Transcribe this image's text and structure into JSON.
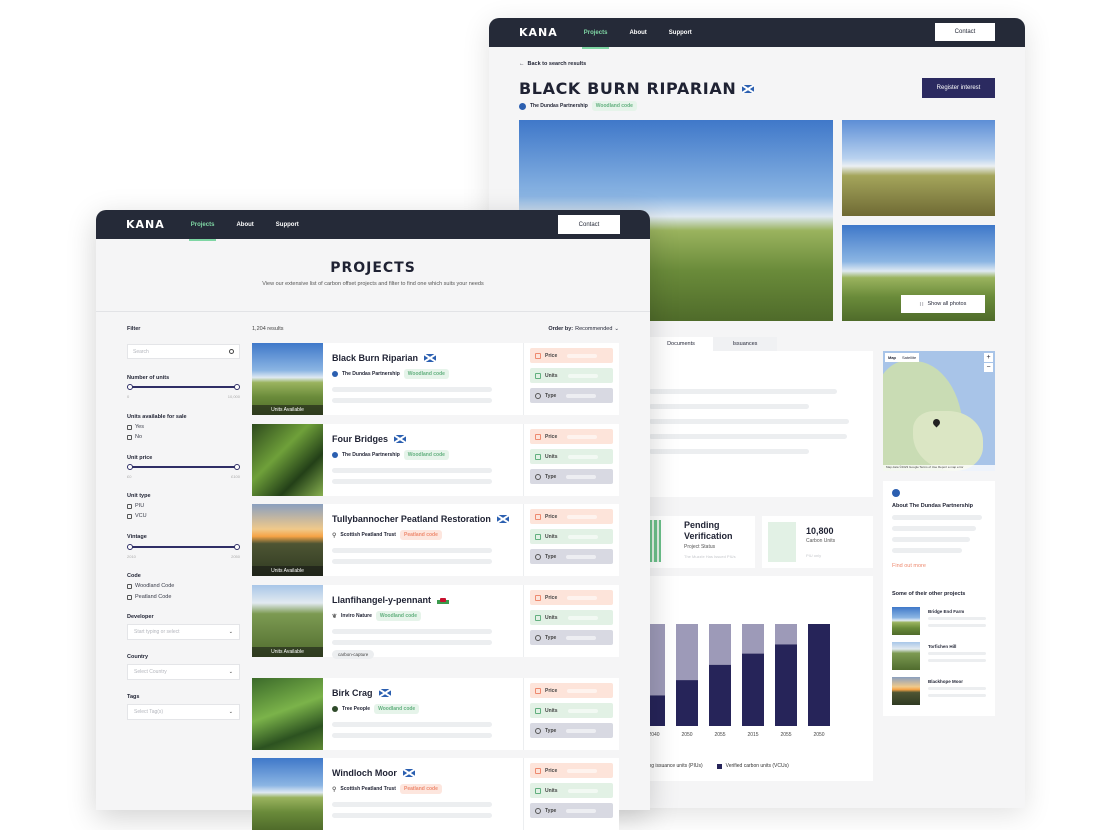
{
  "back_window": {
    "nav": {
      "logo": "KANA",
      "items": [
        "Projects",
        "About",
        "Support"
      ],
      "contact": "Contact"
    },
    "back_link": "Back to search results",
    "title": "BLACK BURN RIPARIAN",
    "developer": "The Dundas Partnership",
    "code_chip": "Woodland code",
    "register_button": "Register interest",
    "show_photos": "Show all photos",
    "tabs": [
      "Documents",
      "Issuances"
    ],
    "status": {
      "title_line1": "Pending",
      "title_line2": "Verification",
      "sub": "Project Status",
      "faint": "The Muzzle Has Issued PIUs"
    },
    "units": {
      "value": "10,800",
      "sub": "Carbon Units",
      "faint": "PIU only"
    },
    "map": {
      "tab_map": "Map",
      "tab_sat": "Satellite",
      "zoom_in": "+",
      "zoom_out": "−",
      "footer": "Map data ©2023 Google   Terms of Use   Report a map error"
    },
    "about": {
      "title": "About The Dundas Partnership",
      "link": "Find out more"
    },
    "other_projects": {
      "title": "Some of their other projects",
      "items": [
        "Bridge End Farm",
        "Torfichen Hill",
        "Blackhope Moor"
      ]
    },
    "legend": {
      "pending": "ending issuance units (PIUs)",
      "verified": "Verified carbon units (VCUs)"
    },
    "colors": {
      "navy": "#252a38",
      "pending": "#9d9ab8",
      "verified": "#262459",
      "accent": "#7fd6a4"
    }
  },
  "front_window": {
    "nav": {
      "logo": "KANA",
      "items": [
        "Projects",
        "About",
        "Support"
      ],
      "contact": "Contact"
    },
    "heading": "PROJECTS",
    "subheading": "View our extensive list of carbon offset projects and filter to find one which suits your needs",
    "filter": {
      "title": "Filter",
      "search_placeholder": "Search",
      "number_of_units": {
        "label": "Number of units",
        "min": "0",
        "max": "10,000"
      },
      "available": {
        "label": "Units available for sale",
        "options": [
          "Yes",
          "No"
        ]
      },
      "unit_price": {
        "label": "Unit price",
        "min": "£0",
        "max": "£100"
      },
      "unit_type": {
        "label": "Unit type",
        "options": [
          "PIU",
          "VCU"
        ]
      },
      "vintage": {
        "label": "Vintage",
        "min": "2010",
        "max": "2050"
      },
      "code": {
        "label": "Code",
        "options": [
          "Woodland Code",
          "Peatland Code"
        ]
      },
      "developer": {
        "label": "Developer",
        "placeholder": "Start typing or select"
      },
      "country": {
        "label": "Country",
        "placeholder": "Select Country"
      },
      "tags": {
        "label": "Tags",
        "placeholder": "Select Tag(s)"
      }
    },
    "results_count": "1,204 results",
    "order_by": {
      "label": "Order by:",
      "value": "Recommended"
    },
    "pill_labels": {
      "price": "Price",
      "units": "Units",
      "type": "Type"
    },
    "units_available": "Units Available",
    "projects": [
      {
        "name": "Black Burn Riparian",
        "developer": "The Dundas Partnership",
        "code": "Woodland code",
        "flag": "scotland",
        "units_available": true
      },
      {
        "name": "Four Bridges",
        "developer": "The Dundas Partnership",
        "code": "Woodland code",
        "flag": "scotland",
        "units_available": false
      },
      {
        "name": "Tullybannocher Peatland Restoration",
        "developer": "Scottish Peatland Trust",
        "code": "Peatland code",
        "flag": "scotland",
        "units_available": true
      },
      {
        "name": "Llanfihangel-y-pennant",
        "developer": "Inviro Nature",
        "code": "Woodland code",
        "flag": "wales",
        "units_available": true,
        "tag": "carbon-capture"
      },
      {
        "name": "Birk Crag",
        "developer": "Tree People",
        "code": "Woodland code",
        "flag": "scotland",
        "units_available": false
      },
      {
        "name": "Windloch Moor",
        "developer": "Scottish Peatland Trust",
        "code": "Peatland code",
        "flag": "scotland",
        "units_available": false
      }
    ]
  },
  "chart_data": {
    "type": "bar",
    "categories": [
      "2040",
      "2050",
      "2055",
      "2015",
      "2055",
      "2050"
    ],
    "series": [
      {
        "name": "ending issuance units (PIUs)",
        "values": [
          100,
          100,
          100,
          100,
          100,
          100
        ]
      },
      {
        "name": "Verified carbon units (VCUs)",
        "values": [
          30,
          45,
          60,
          71,
          80,
          100
        ]
      }
    ],
    "stacked": true
  }
}
